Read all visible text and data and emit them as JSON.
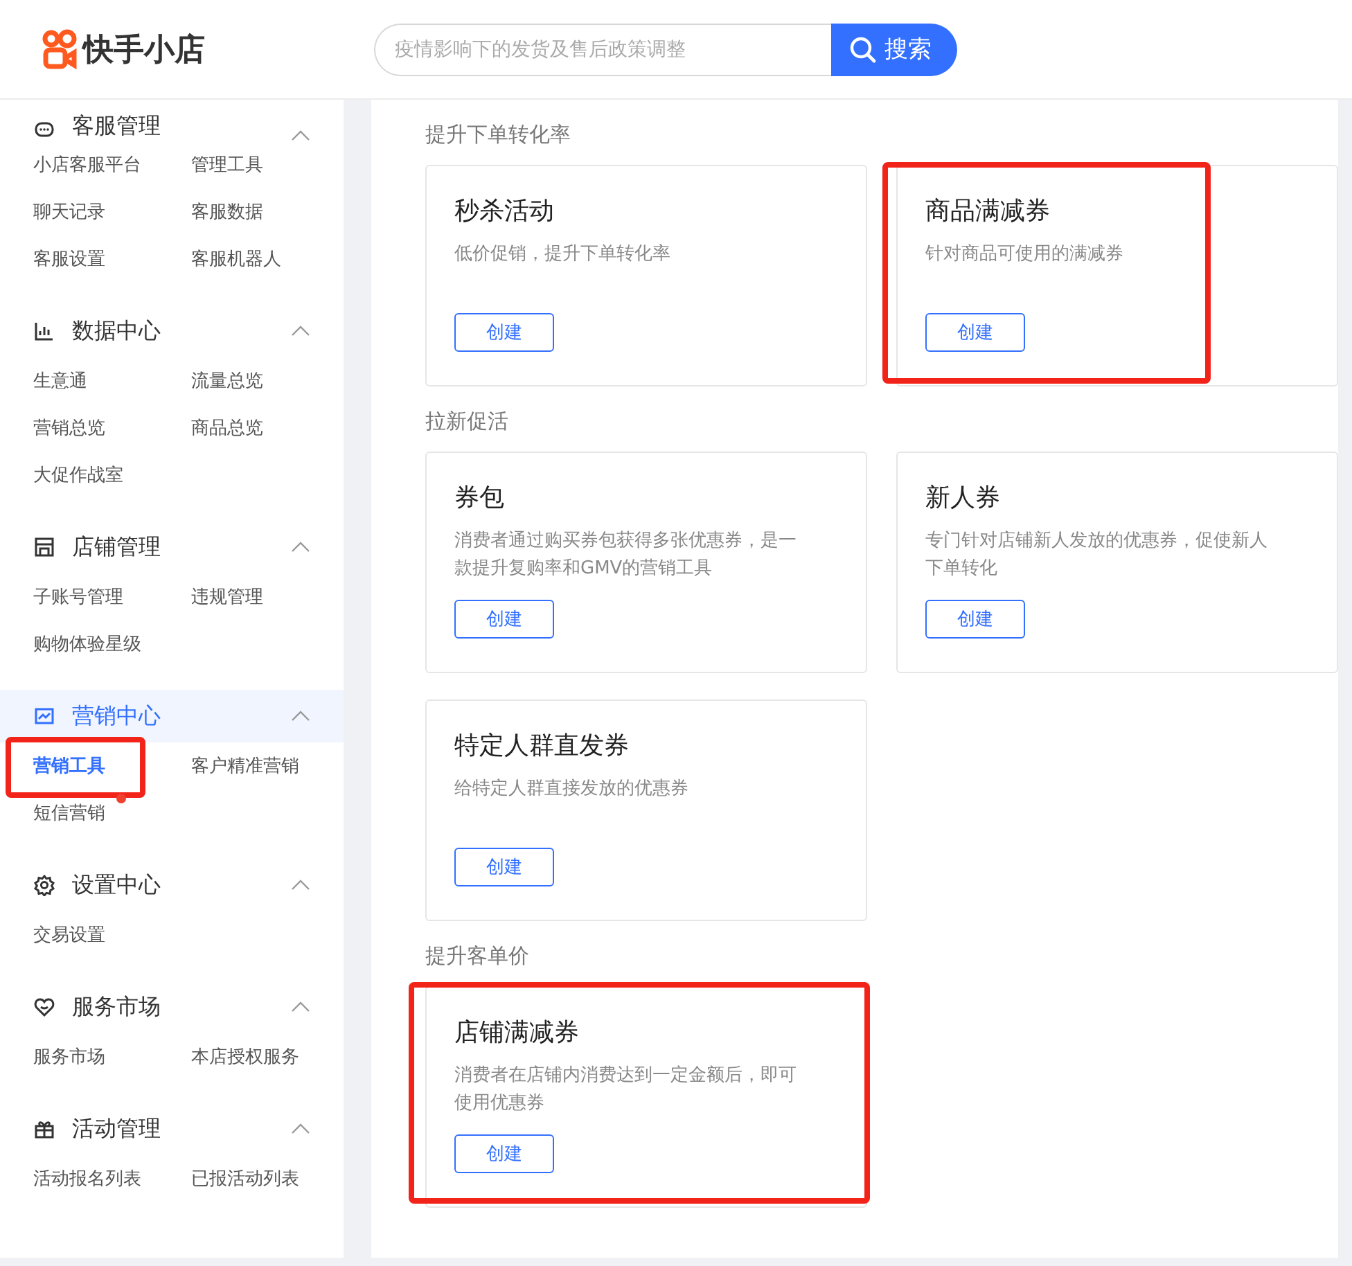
{
  "header": {
    "logo_text": "快手小店",
    "search": {
      "placeholder": "疫情影响下的发货及售后政策调整",
      "button": "搜索"
    }
  },
  "sidebar": {
    "groups": [
      {
        "title": "客服管理",
        "expanded": true,
        "selected": false,
        "items": [
          {
            "label": "小店客服平台",
            "selected": false
          },
          {
            "label": "管理工具",
            "selected": false
          },
          {
            "label": "聊天记录",
            "selected": false
          },
          {
            "label": "客服数据",
            "selected": false
          },
          {
            "label": "客服设置",
            "selected": false
          },
          {
            "label": "客服机器人",
            "selected": false
          }
        ]
      },
      {
        "title": "数据中心",
        "expanded": true,
        "selected": false,
        "items": [
          {
            "label": "生意通",
            "selected": false
          },
          {
            "label": "流量总览",
            "selected": false
          },
          {
            "label": "营销总览",
            "selected": false
          },
          {
            "label": "商品总览",
            "selected": false
          },
          {
            "label": "大促作战室",
            "selected": false
          }
        ]
      },
      {
        "title": "店铺管理",
        "expanded": true,
        "selected": false,
        "items": [
          {
            "label": "子账号管理",
            "selected": false
          },
          {
            "label": "违规管理",
            "selected": false
          },
          {
            "label": "购物体验星级",
            "selected": false
          }
        ]
      },
      {
        "title": "营销中心",
        "expanded": true,
        "selected": true,
        "items": [
          {
            "label": "营销工具",
            "selected": true,
            "highlighted": true
          },
          {
            "label": "客户精准营销",
            "selected": false
          },
          {
            "label": "短信营销",
            "selected": false,
            "dot": true
          }
        ]
      },
      {
        "title": "设置中心",
        "expanded": true,
        "selected": false,
        "items": [
          {
            "label": "交易设置",
            "selected": false
          }
        ]
      },
      {
        "title": "服务市场",
        "expanded": true,
        "selected": false,
        "items": [
          {
            "label": "服务市场",
            "selected": false
          },
          {
            "label": "本店授权服务",
            "selected": false
          }
        ]
      },
      {
        "title": "活动管理",
        "expanded": true,
        "selected": false,
        "items": [
          {
            "label": "活动报名列表",
            "selected": false
          },
          {
            "label": "已报活动列表",
            "selected": false
          }
        ]
      }
    ]
  },
  "sections": [
    {
      "title": "提升下单转化率",
      "cards": [
        {
          "title": "秒杀活动",
          "description": "低价促销，提升下单转化率",
          "button": "创建",
          "highlighted": false
        },
        {
          "title": "商品满减券",
          "description": "针对商品可使用的满减券",
          "button": "创建",
          "highlighted": true
        }
      ]
    },
    {
      "title": "拉新促活",
      "cards": [
        {
          "title": "券包",
          "description": "消费者通过购买券包获得多张优惠券，是一款提升复购率和GMV的营销工具",
          "button": "创建",
          "highlighted": false
        },
        {
          "title": "新人券",
          "description": "专门针对店铺新人发放的优惠券，促使新人下单转化",
          "button": "创建",
          "highlighted": false
        },
        {
          "title": "特定人群直发券",
          "description": "给特定人群直接发放的优惠券",
          "button": "创建",
          "highlighted": false
        }
      ]
    },
    {
      "title": "提升客单价",
      "cards": [
        {
          "title": "店铺满减券",
          "description": "消费者在店铺内消费达到一定金额后，即可使用优惠券",
          "button": "创建",
          "highlighted": true
        }
      ]
    }
  ]
}
